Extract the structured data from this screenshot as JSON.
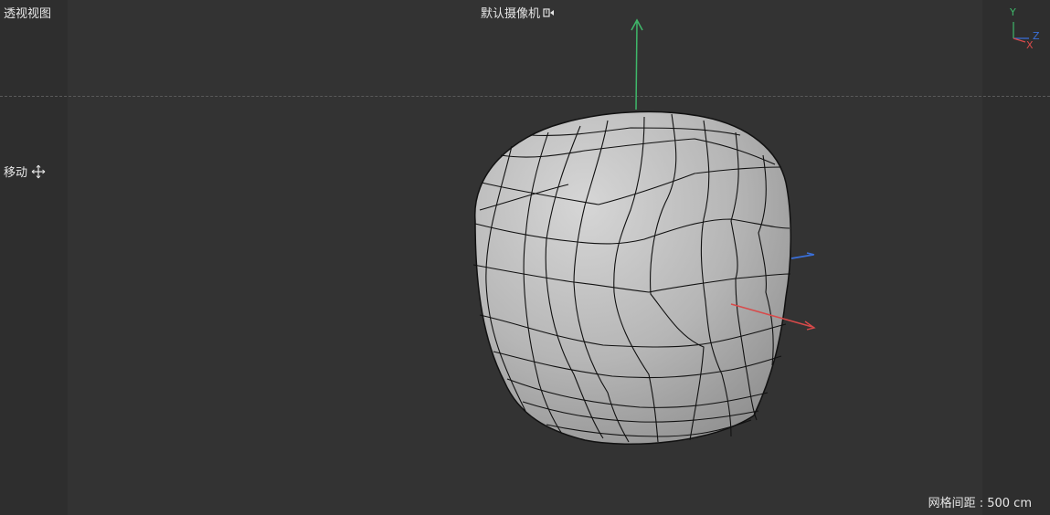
{
  "viewport": {
    "title": "透视视图",
    "camera_label": "默认摄像机",
    "tool_label": "移动",
    "grid_spacing": "网格间距 : 500 cm",
    "axis_labels": {
      "x": "X",
      "y": "Y",
      "z": "Z"
    }
  },
  "colors": {
    "viewport_bg": "#333333",
    "sidebar_bg": "#2e2e2e",
    "mesh_fill": "#b8b8b8",
    "mesh_wire": "#111111",
    "axis_x": "#d84a4a",
    "axis_y": "#3fb86a",
    "axis_z": "#3a6fd8"
  },
  "icons": {
    "camera": "camera-icon",
    "move": "move-icon",
    "axis_gizmo": "axis-gizmo-icon"
  }
}
